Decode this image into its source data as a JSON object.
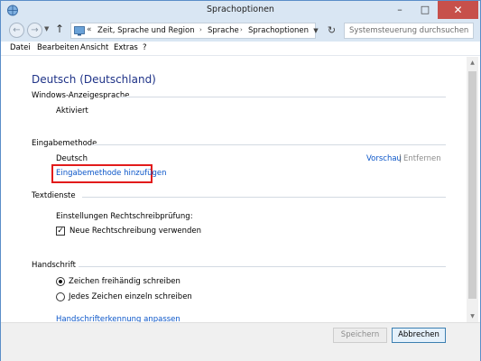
{
  "window": {
    "title": "Sprachoptionen"
  },
  "address": {
    "crumbs": [
      "Zeit, Sprache und Region",
      "Sprache",
      "Sprachoptionen"
    ]
  },
  "search": {
    "placeholder": "Systemsteuerung durchsuchen"
  },
  "menu": [
    "Datei",
    "Bearbeiten",
    "Ansicht",
    "Extras",
    "?"
  ],
  "main": {
    "title": "Deutsch (Deutschland)",
    "display_language": {
      "header": "Windows-Anzeigesprache",
      "status": "Aktiviert"
    },
    "input_method": {
      "header": "Eingabemethode",
      "name": "Deutsch",
      "preview_link": "Vorschau",
      "separator": "|",
      "remove_link": "Entfernen",
      "add_link": "Eingabemethode hinzufügen"
    },
    "text_services": {
      "header": "Textdienste",
      "spellcheck_label": "Einstellungen Rechtschreibprüfung:",
      "new_spelling_label": "Neue Rechtschreibung verwenden",
      "new_spelling_checked": true
    },
    "handwriting": {
      "header": "Handschrift",
      "option_free": "Zeichen freihändig schreiben",
      "option_single": "Jedes Zeichen einzeln schreiben",
      "selected": "option_free",
      "customize_link": "Handschrifterkennung anpassen"
    }
  },
  "footer": {
    "save_label": "Speichern",
    "cancel_label": "Abbrechen"
  }
}
